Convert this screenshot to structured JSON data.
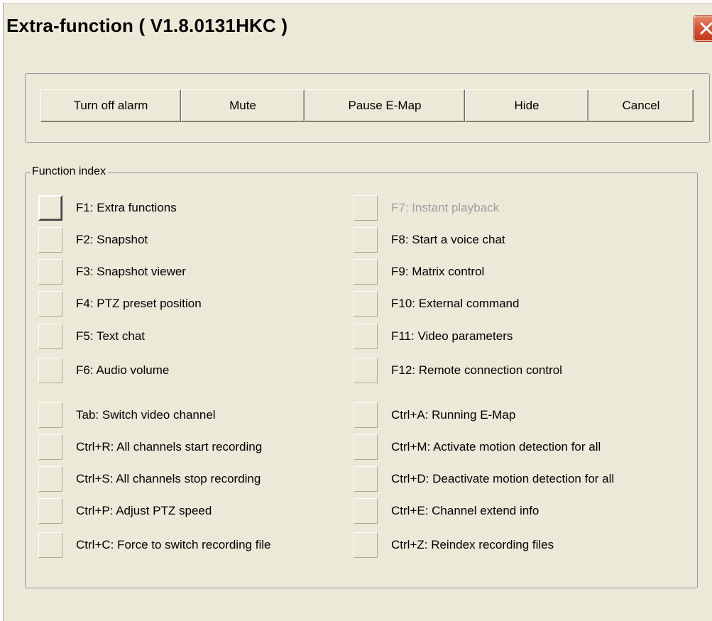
{
  "window": {
    "title": "Extra-function ( V1.8.0131HKC )"
  },
  "toolbar": {
    "turn_off_alarm": "Turn off alarm",
    "mute": "Mute",
    "pause_emap": "Pause E-Map",
    "hide": "Hide",
    "cancel": "Cancel"
  },
  "function_index": {
    "legend": "Function index",
    "left": [
      {
        "label": "F1: Extra functions",
        "state": "active"
      },
      {
        "label": "F2: Snapshot"
      },
      {
        "label": "F3: Snapshot viewer"
      },
      {
        "label": "F4: PTZ preset position"
      },
      {
        "label": "F5: Text chat"
      },
      {
        "label": "F6: Audio volume"
      },
      {
        "label": "Tab: Switch video channel"
      },
      {
        "label": "Ctrl+R: All channels start recording"
      },
      {
        "label": "Ctrl+S: All channels stop recording"
      },
      {
        "label": "Ctrl+P: Adjust PTZ speed"
      },
      {
        "label": "Ctrl+C: Force to switch recording file"
      }
    ],
    "right": [
      {
        "label": "F7: Instant playback",
        "state": "disabled"
      },
      {
        "label": "F8: Start a voice chat"
      },
      {
        "label": "F9: Matrix control"
      },
      {
        "label": "F10: External command"
      },
      {
        "label": "F11: Video parameters"
      },
      {
        "label": "F12: Remote connection control"
      },
      {
        "label": "Ctrl+A: Running E-Map"
      },
      {
        "label": "Ctrl+M: Activate motion detection for all"
      },
      {
        "label": "Ctrl+D: Deactivate motion detection for all"
      },
      {
        "label": "Ctrl+E: Channel extend info"
      },
      {
        "label": "Ctrl+Z: Reindex recording files"
      }
    ]
  },
  "colors": {
    "dialog_bg": "#ece9d8",
    "close_button": "#d4583a",
    "disabled_text": "#a0a0a0"
  },
  "icons": {
    "close": "close-icon"
  }
}
